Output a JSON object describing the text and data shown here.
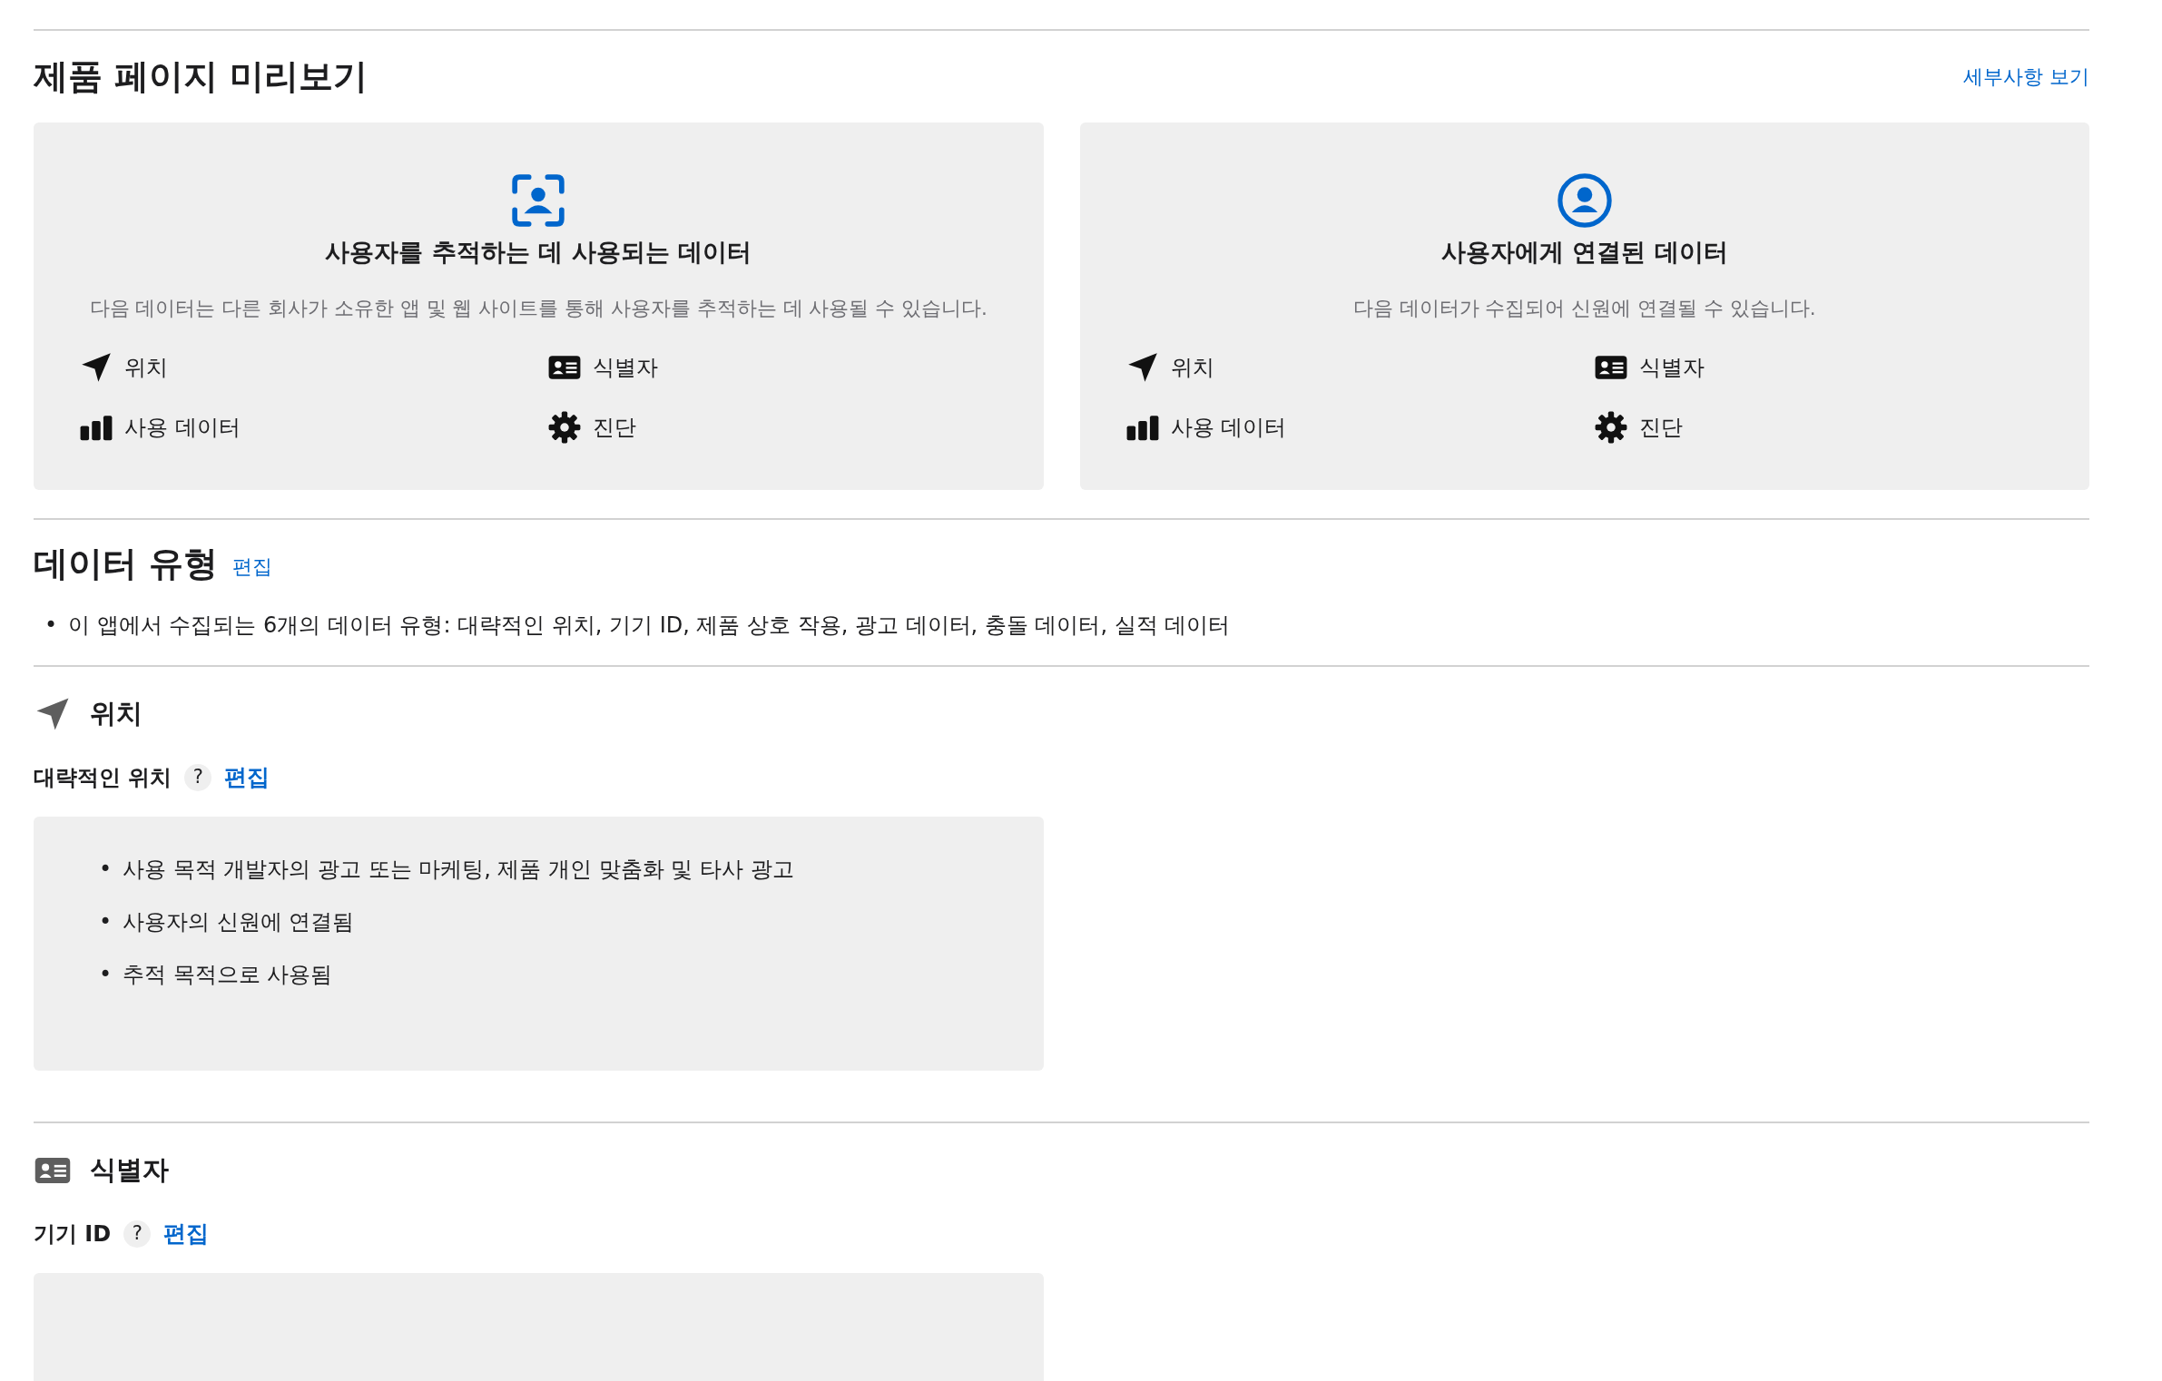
{
  "preview": {
    "title": "제품 페이지 미리보기",
    "link": "세부사항 보기",
    "cards": [
      {
        "kind": "tracking",
        "title": "사용자를 추적하는 데 사용되는 데이터",
        "description": "다음 데이터는 다른 회사가 소유한 앱 및 웹 사이트를 통해 사용자를 추적하는 데 사용될 수 있습니다.",
        "items": [
          {
            "kind": "location",
            "label": "위치"
          },
          {
            "kind": "identifier",
            "label": "식별자"
          },
          {
            "kind": "usage",
            "label": "사용 데이터"
          },
          {
            "kind": "diagnostics",
            "label": "진단"
          }
        ]
      },
      {
        "kind": "linked",
        "title": "사용자에게 연결된 데이터",
        "description": "다음 데이터가 수집되어 신원에 연결될 수 있습니다.",
        "items": [
          {
            "kind": "location",
            "label": "위치"
          },
          {
            "kind": "identifier",
            "label": "식별자"
          },
          {
            "kind": "usage",
            "label": "사용 데이터"
          },
          {
            "kind": "diagnostics",
            "label": "진단"
          }
        ]
      }
    ]
  },
  "data_types": {
    "title": "데이터 유형",
    "edit_link": "편집",
    "marker": "•",
    "items": [
      "이 앱에서 수집되는 6개의 데이터 유형: 대략적인 위치, 기기 ID, 제품 상호 작용, 광고 데이터, 충돌 데이터, 실적 데이터"
    ]
  },
  "sections": [
    {
      "kind": "location",
      "title": "위치",
      "entries": [
        {
          "name": "대략적인 위치",
          "help": "?",
          "edit_link": "편집",
          "marker": "•",
          "bullets": [
            "사용 목적 개발자의 광고 또는 마케팅, 제품 개인 맞춤화 및 타사 광고",
            "사용자의 신원에 연결됨",
            "추적 목적으로 사용됨"
          ]
        }
      ]
    },
    {
      "kind": "identifier",
      "title": "식별자",
      "entries": [
        {
          "name": "기기 ID",
          "help": "?",
          "edit_link": "편집"
        }
      ]
    }
  ]
}
